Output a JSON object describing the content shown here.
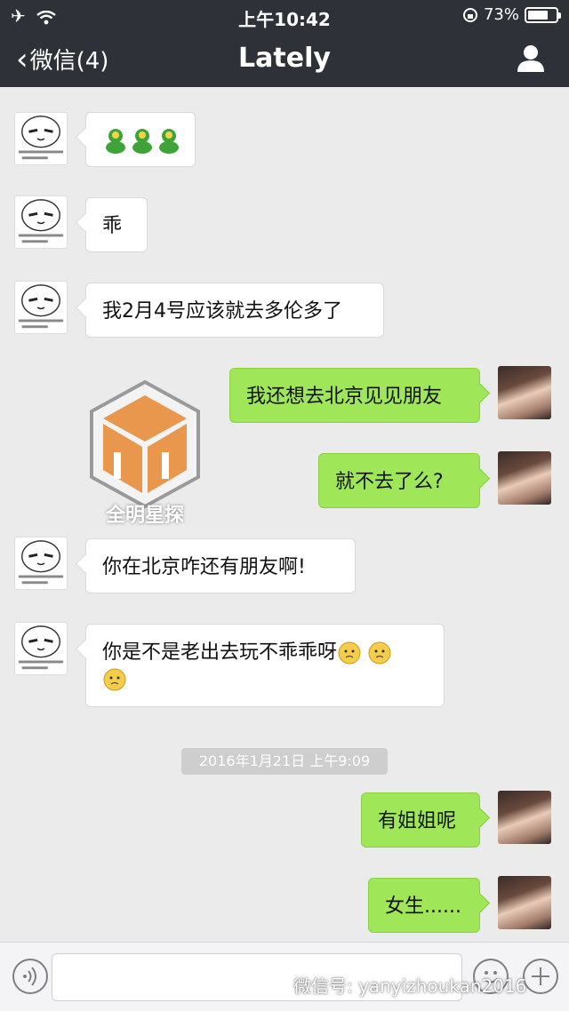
{
  "status_bar": {
    "time": "上午10:42",
    "battery_percent": "73%",
    "battery_level": 0.73,
    "airplane_icon": "airplane-icon",
    "wifi_icon": "wifi-icon",
    "rotation_lock_icon": "rotation-lock-icon"
  },
  "nav": {
    "back_label": "微信(4)",
    "title": "Lately",
    "profile_icon": "person-icon"
  },
  "messages": [
    {
      "side": "in",
      "text": ""
    },
    {
      "side": "in",
      "text": "乖"
    },
    {
      "side": "in",
      "text": "我2月4号应该就去多伦多了"
    },
    {
      "side": "out",
      "text": "我还想去北京见见朋友"
    },
    {
      "side": "out",
      "text": "就不去了么?"
    },
    {
      "side": "in",
      "text": "你在北京咋还有朋友啊!"
    },
    {
      "side": "in",
      "text": "你是不是老出去玩不乖乖呀"
    },
    {
      "side": "out",
      "text": "有姐姐呢"
    },
    {
      "side": "out",
      "text": "女生......"
    }
  ],
  "timestamp": "2016年1月21日 上午9:09",
  "watermark": "全明星探",
  "wechat_watermark": "微信号: yanyizhoukan2016",
  "colors": {
    "nav_bg": "#2e3238",
    "chat_bg": "#ebebeb",
    "outgoing_bubble": "#9fe658",
    "incoming_bubble": "#ffffff"
  }
}
